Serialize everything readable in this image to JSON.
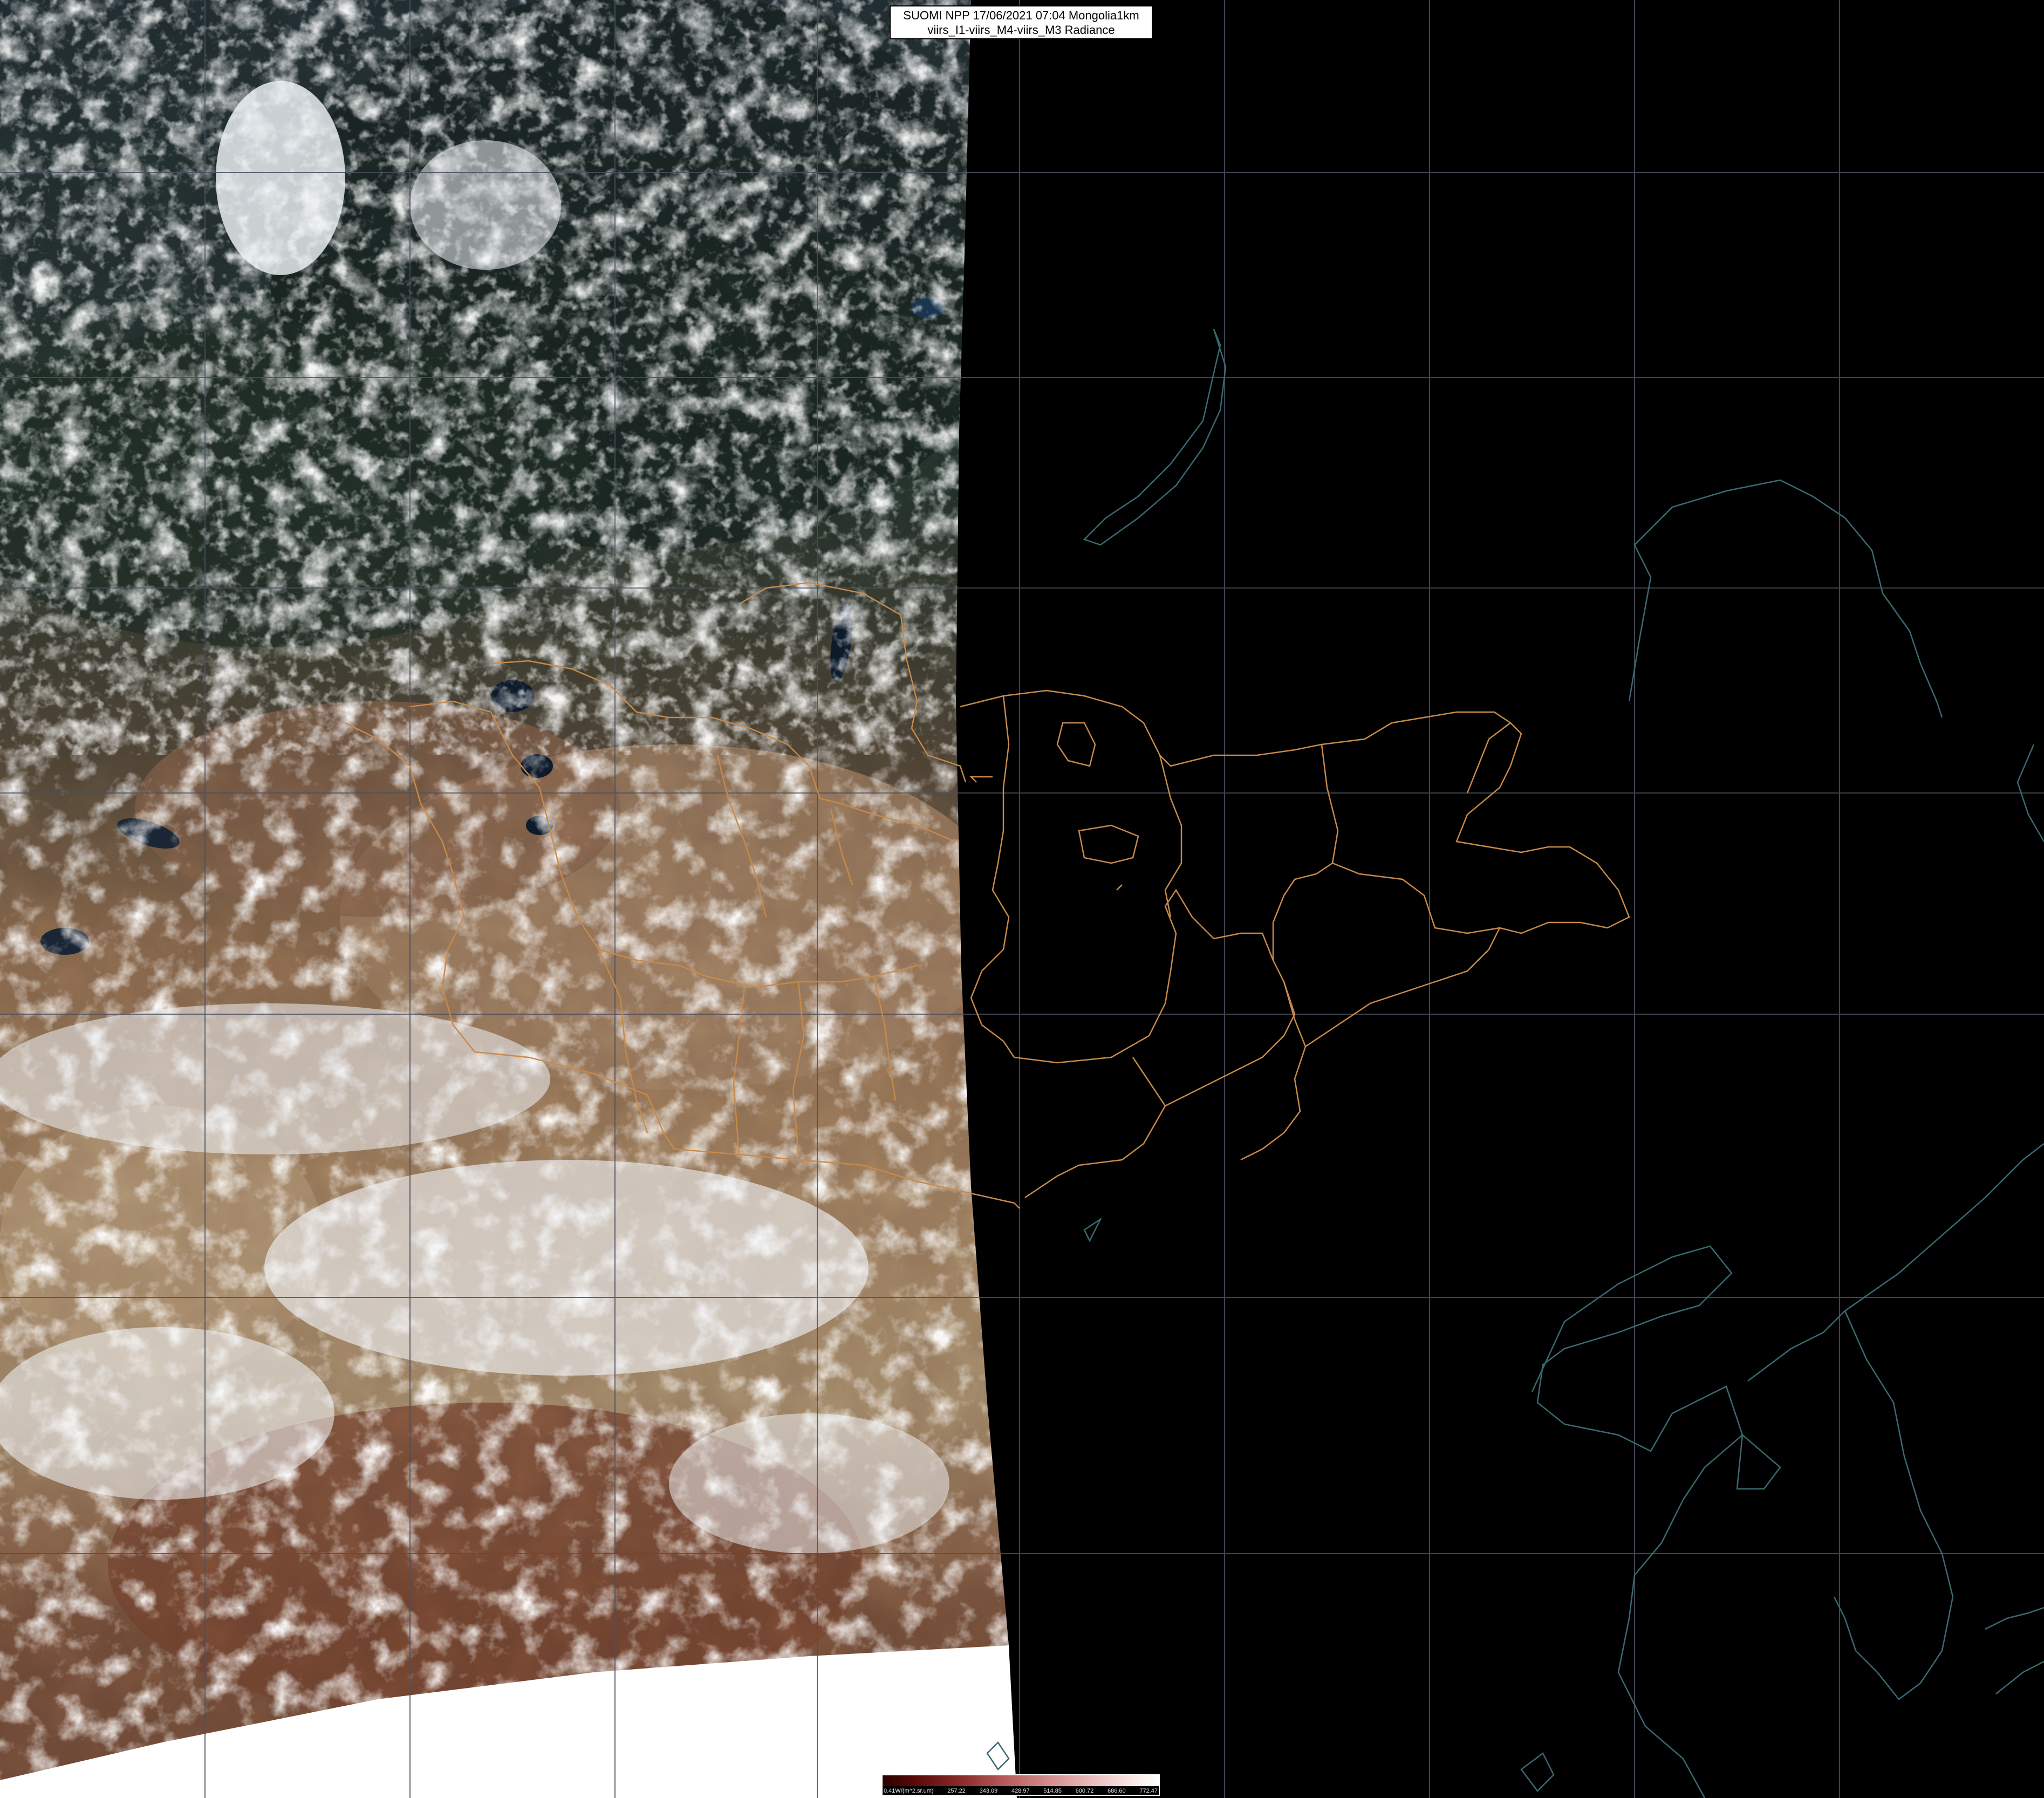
{
  "header": {
    "line1": "SUOMI NPP 17/06/2021 07:04 Mongolia1km",
    "line2": "viirs_I1-viirs_M4-viirs_M3 Radiance"
  },
  "colorbar": {
    "unit": "0.41W/(m^2.sr.um)",
    "ticks": [
      "257.22",
      "343.09",
      "428.97",
      "514.85",
      "600.72",
      "686.60",
      "772.47"
    ],
    "ramp_colors": [
      "#2a0000",
      "#8a2a2a",
      "#d48c8c",
      "#ffffff"
    ]
  },
  "colors": {
    "night_side": "#000000",
    "grid": "#4a5060",
    "admin_borders": "#c88a4a",
    "coastlines": "#3a6a74",
    "cloud": "#f4f7fb",
    "desert": "#8f6f52",
    "forest": "#1d2a22"
  }
}
